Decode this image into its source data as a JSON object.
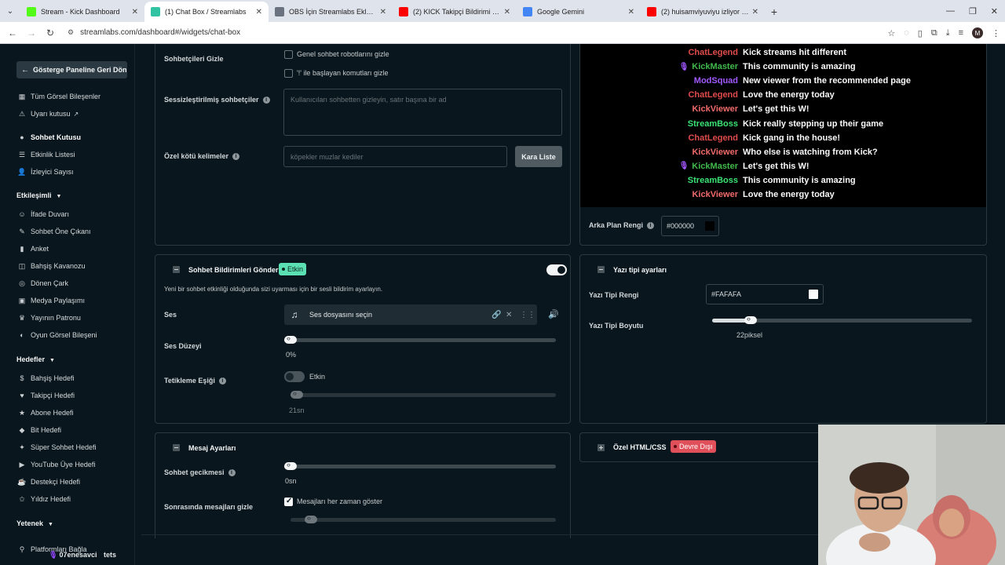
{
  "browser": {
    "tabs": [
      {
        "title": "Stream - Kick Dashboard",
        "color": "#53fc18"
      },
      {
        "title": "(1) Chat Box / Streamlabs",
        "color": "#31c3a2",
        "active": true
      },
      {
        "title": "OBS İçin Streamlabs Eklentisi | S",
        "color": "#6b7280"
      },
      {
        "title": "(2) KICK Takipçi Bildirimi ve Ekra",
        "color": "#ff0000"
      },
      {
        "title": "Google Gemini",
        "color": "#4285f4"
      },
      {
        "title": "(2) huisamviyuviyu izliyor - YouT",
        "color": "#ff0000"
      }
    ],
    "url": "streamlabs.com/dashboard#/widgets/chat-box",
    "profile_initial": "M"
  },
  "sidebar": {
    "back": "Gösterge Paneline Geri Dön",
    "items_top": [
      {
        "label": "Tüm Görsel Bileşenler",
        "icon": "grid-icon"
      },
      {
        "label": "Uyarı kutusu",
        "icon": "bell-icon"
      },
      {
        "label": "Sohbet Kutusu",
        "icon": "chat-icon"
      },
      {
        "label": "Etkinlik Listesi",
        "icon": "list-icon"
      },
      {
        "label": "İzleyici Sayısı",
        "icon": "user-icon"
      }
    ],
    "section1": "Etkileşimli",
    "items_interactive": [
      {
        "label": "İfade Duvarı",
        "icon": "smile-icon"
      },
      {
        "label": "Sohbet Öne Çıkanı",
        "icon": "pin-icon"
      },
      {
        "label": "Anket",
        "icon": "bar-icon"
      },
      {
        "label": "Bahşiş Kavanozu",
        "icon": "jar-icon"
      },
      {
        "label": "Dönen Çark",
        "icon": "wheel-icon"
      },
      {
        "label": "Medya Paylaşımı",
        "icon": "media-icon"
      },
      {
        "label": "Yayının Patronu",
        "icon": "crown-icon"
      },
      {
        "label": "Oyun Görsel Bileşeni",
        "icon": "game-icon"
      }
    ],
    "section2": "Hedefler",
    "items_goals": [
      {
        "label": "Bahşiş Hedefi",
        "icon": "tip-icon"
      },
      {
        "label": "Takipçi Hedefi",
        "icon": "follower-icon"
      },
      {
        "label": "Abone Hedefi",
        "icon": "sub-icon"
      },
      {
        "label": "Bit Hedefi",
        "icon": "bit-icon"
      },
      {
        "label": "Süper Sohbet Hedefi",
        "icon": "superchat-icon"
      },
      {
        "label": "YouTube Üye Hedefi",
        "icon": "youtube-icon"
      },
      {
        "label": "Destekçi Hedefi",
        "icon": "supporter-icon"
      },
      {
        "label": "Yıldız Hedefi",
        "icon": "star-icon"
      }
    ],
    "section3": "Yetenek",
    "connect": "Platformları Bağla",
    "user": "07enesavci",
    "user_suffix": "tets"
  },
  "hide_chatters": {
    "label": "Sohbetçileri Gizle",
    "opt1": "Genel sohbet robotlarını gizle",
    "opt2": "'!' ile başlayan komutları gizle",
    "muted_label": "Sessizleştirilmiş sohbetçiler",
    "muted_placeholder": "Kullanıcıları sohbetten gizleyin, satır başına bir ad",
    "badwords_label": "Özel kötü kelimeler",
    "badwords_placeholder": "köpekler muzlar kediler",
    "blacklist_button": "Kara Liste"
  },
  "chat_preview": [
    {
      "name": "ChatLegend",
      "color": "#e04b4b",
      "msg": "Kick streams hit different",
      "mic": false
    },
    {
      "name": "KickMaster",
      "color": "#40b94d",
      "msg": "This community is amazing",
      "mic": true
    },
    {
      "name": "ModSquad",
      "color": "#a259ff",
      "msg": "New viewer from the recommended page",
      "mic": false
    },
    {
      "name": "ChatLegend",
      "color": "#e04b4b",
      "msg": "Love the energy today",
      "mic": false
    },
    {
      "name": "KickViewer",
      "color": "#f26b6b",
      "msg": "Let's get this W!",
      "mic": false
    },
    {
      "name": "StreamBoss",
      "color": "#3ae374",
      "msg": "Kick really stepping up their game",
      "mic": false
    },
    {
      "name": "ChatLegend",
      "color": "#e04b4b",
      "msg": "Kick gang in the house!",
      "mic": false
    },
    {
      "name": "KickViewer",
      "color": "#f26b6b",
      "msg": "Who else is watching from Kick?",
      "mic": false
    },
    {
      "name": "KickMaster",
      "color": "#40b94d",
      "msg": "Let's get this W!",
      "mic": true
    },
    {
      "name": "StreamBoss",
      "color": "#3ae374",
      "msg": "This community is amazing",
      "mic": false
    },
    {
      "name": "KickViewer",
      "color": "#f26b6b",
      "msg": "Love the energy today",
      "mic": false
    }
  ],
  "background": {
    "label": "Arka Plan Rengi",
    "value": "#000000"
  },
  "notifications": {
    "title": "Sohbet Bildirimleri Gönder",
    "badge": "Etkin",
    "description": "Yeni bir sohbet etkinliği olduğunda sizi uyarması için bir sesli bildirim ayarlayın.",
    "sound_label": "Ses",
    "sound_file": "Ses dosyasını seçin",
    "volume_label": "Ses Düzeyi",
    "volume_value": "0%",
    "volume_fraction": 0,
    "threshold_label": "Tetikleme Eşiği",
    "threshold_toggle": "Etkin",
    "threshold_value": "21sn"
  },
  "font": {
    "title": "Yazı tipi ayarları",
    "color_label": "Yazı Tipi Rengi",
    "color_value": "#FAFAFA",
    "size_label": "Yazı Tipi Boyutu",
    "size_value": "22piksel"
  },
  "messages": {
    "title": "Mesaj Ayarları",
    "delay_label": "Sohbet gecikmesi",
    "delay_value": "0sn",
    "hide_after_label": "Sonrasında mesajları gizle",
    "always_show": "Mesajları her zaman göster"
  },
  "custom": {
    "title": "Özel HTML/CSS",
    "badge": "Devre Dışı"
  }
}
